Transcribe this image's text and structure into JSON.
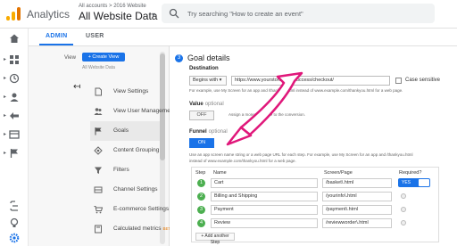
{
  "app": {
    "product_name": "Analytics",
    "account_crumb": "All accounts > 2016 Website",
    "account_name": "All Website Data",
    "search_placeholder": "Try searching \"How to create an event\""
  },
  "tabs": [
    {
      "label": "ADMIN",
      "active": true
    },
    {
      "label": "USER",
      "active": false
    }
  ],
  "view_panel": {
    "label": "View",
    "create_button": "+ Create View",
    "sub": "All Website Data",
    "back": "↤",
    "items": [
      {
        "label": "View Settings",
        "icon": "document-icon"
      },
      {
        "label": "View User Management",
        "icon": "users-icon"
      },
      {
        "label": "Goals",
        "icon": "flag-icon",
        "active": true
      },
      {
        "label": "Content Grouping",
        "icon": "grouping-icon"
      },
      {
        "label": "Filters",
        "icon": "filter-icon"
      },
      {
        "label": "Channel Settings",
        "icon": "channel-icon"
      },
      {
        "label": "E-commerce Settings",
        "icon": "cart-icon"
      },
      {
        "label": "Calculated metrics",
        "badge": "BETA",
        "icon": "calculator-icon"
      }
    ]
  },
  "goal": {
    "step_number": "3",
    "title": "Goal details",
    "destination_label": "Destination",
    "match_type": "Begins with",
    "destination_url": "https://www.yourstore.com/success/checkout/",
    "case_sensitive_label": "Case sensitive",
    "destination_help": "For example, use My Screen for an app and /thankyou.html instead of www.example.com/thankyou.html for a web page.",
    "value_label": "Value",
    "value_optional": "optional",
    "value_toggle": "OFF",
    "value_help": "Assign a monetary value to the conversion.",
    "funnel_label": "Funnel",
    "funnel_optional": "optional",
    "funnel_toggle": "ON",
    "funnel_help_1": "Use an app screen name string or a web page URL for each step. For example, use My Screen for an app and /thankyou.html",
    "funnel_help_2": "instead of www.example.com/thankyou.html for a web page."
  },
  "funnel_table": {
    "headers": {
      "step": "Step",
      "name": "Name",
      "page": "Screen/Page",
      "required": "Required?"
    },
    "rows": [
      {
        "step": "1",
        "name": "Cart",
        "page": "/basket\\.html",
        "required": "YES"
      },
      {
        "step": "2",
        "name": "Billing and Shipping",
        "page": "/yourinfo\\.html",
        "required": ""
      },
      {
        "step": "3",
        "name": "Payment",
        "page": "/payment\\.html",
        "required": ""
      },
      {
        "step": "4",
        "name": "Review",
        "page": "/reviewworder\\.html",
        "required": ""
      }
    ],
    "add_step": "+ Add another Step"
  },
  "colors": {
    "accent": "#1a73e8",
    "step_badge": "#4caf50",
    "annotation_arrow": "#e0177a",
    "logo_orange": "#e37400"
  }
}
